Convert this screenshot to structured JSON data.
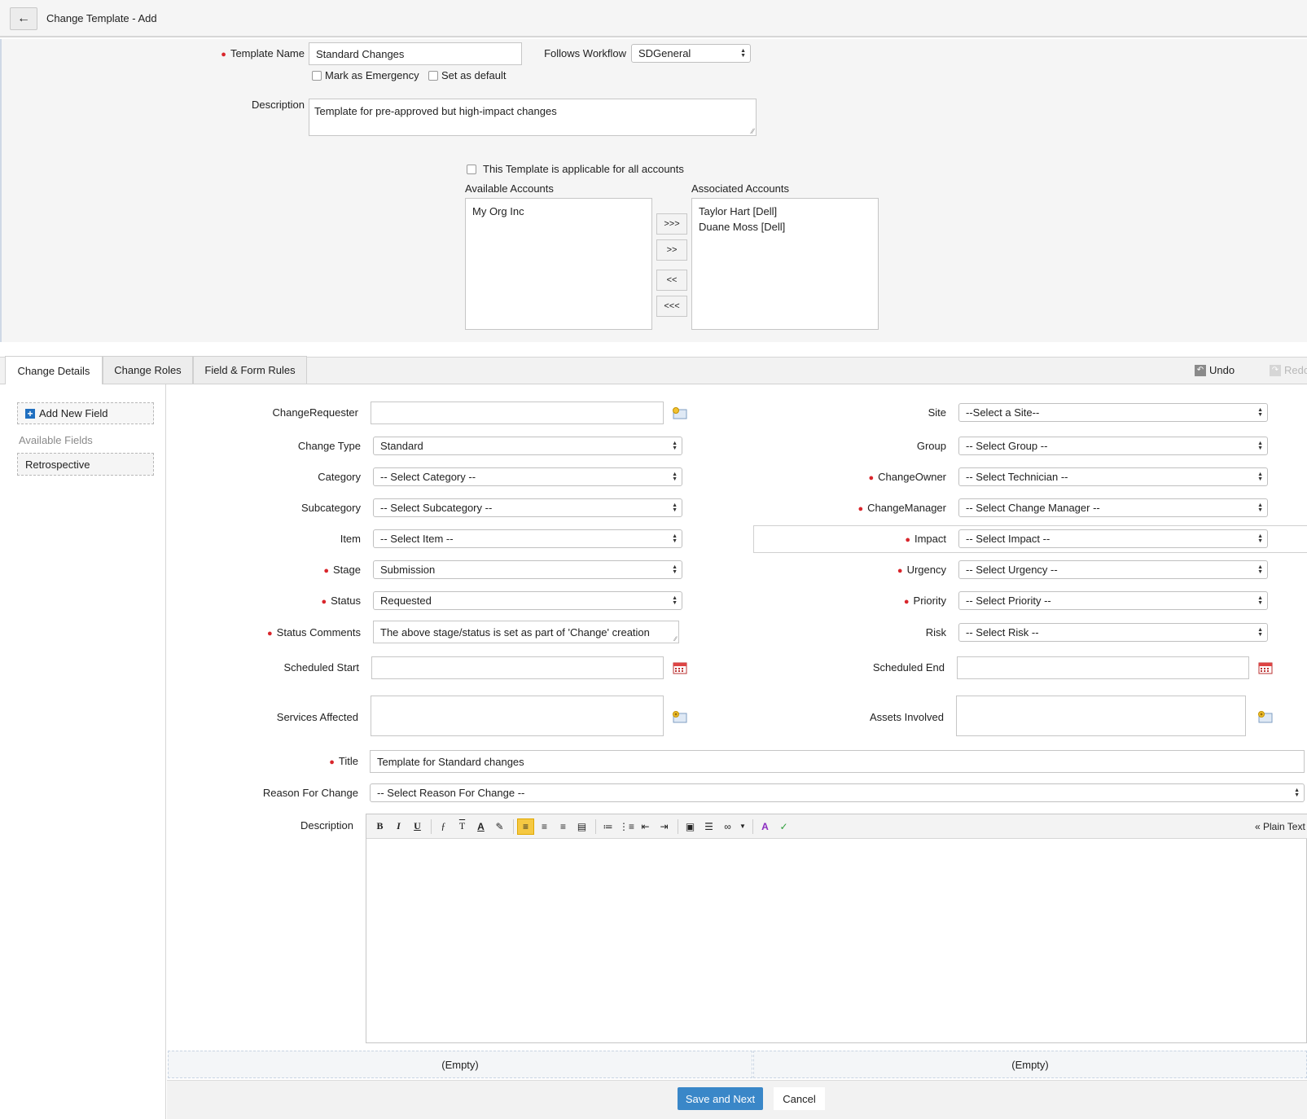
{
  "header": {
    "title": "Change Template - Add"
  },
  "template": {
    "name_label": "Template Name",
    "name_value": "Standard Changes",
    "workflow_label": "Follows Workflow",
    "workflow_value": "SDGeneral",
    "emergency_label": "Mark as Emergency",
    "default_label": "Set as default",
    "description_label": "Description",
    "description_value": "Template for pre-approved but high-impact changes"
  },
  "accounts": {
    "all_accounts_label": "This Template is applicable for all accounts",
    "available_label": "Available Accounts",
    "associated_label": "Associated Accounts",
    "available": [
      "My Org Inc"
    ],
    "associated": [
      "Taylor Hart [Dell]",
      "Duane Moss [Dell]"
    ],
    "move_all_right": ">>>",
    "move_right": ">>",
    "move_left": "<<",
    "move_all_left": "<<<"
  },
  "tabs": [
    {
      "label": "Change Details"
    },
    {
      "label": "Change Roles"
    },
    {
      "label": "Field & Form Rules"
    }
  ],
  "toolbar": {
    "undo": "Undo",
    "redo": "Redo"
  },
  "sidebar": {
    "add_field": "Add New Field",
    "available_fields": "Available Fields",
    "fields": [
      "Retrospective"
    ]
  },
  "form": {
    "change_requester": {
      "label": "ChangeRequester",
      "value": ""
    },
    "site": {
      "label": "Site",
      "value": "--Select a Site--"
    },
    "change_type": {
      "label": "Change Type",
      "value": "Standard"
    },
    "group": {
      "label": "Group",
      "value": "-- Select Group --"
    },
    "category": {
      "label": "Category",
      "value": "-- Select Category --"
    },
    "change_owner": {
      "label": "ChangeOwner",
      "value": "-- Select Technician --"
    },
    "subcategory": {
      "label": "Subcategory",
      "value": "-- Select Subcategory --"
    },
    "change_manager": {
      "label": "ChangeManager",
      "value": "-- Select Change Manager --"
    },
    "item": {
      "label": "Item",
      "value": "-- Select Item --"
    },
    "impact": {
      "label": "Impact",
      "value": "-- Select Impact --"
    },
    "stage": {
      "label": "Stage",
      "value": "Submission"
    },
    "urgency": {
      "label": "Urgency",
      "value": "-- Select Urgency --"
    },
    "status": {
      "label": "Status",
      "value": "Requested"
    },
    "priority": {
      "label": "Priority",
      "value": "-- Select Priority --"
    },
    "status_comments": {
      "label": "Status Comments",
      "value": "The above stage/status is set as part of 'Change' creation"
    },
    "risk": {
      "label": "Risk",
      "value": "-- Select Risk --"
    },
    "scheduled_start": {
      "label": "Scheduled Start",
      "value": ""
    },
    "scheduled_end": {
      "label": "Scheduled End",
      "value": ""
    },
    "services_affected": {
      "label": "Services Affected"
    },
    "assets_involved": {
      "label": "Assets Involved"
    },
    "title": {
      "label": "Title",
      "value": "Template for Standard changes"
    },
    "reason": {
      "label": "Reason For Change",
      "value": "-- Select Reason For Change --"
    },
    "description": {
      "label": "Description",
      "plain_text": "« Plain Text"
    }
  },
  "empty_slots": [
    "(Empty)",
    "(Empty)"
  ],
  "actions": {
    "save_next": "Save and Next",
    "cancel": "Cancel"
  },
  "colors": {
    "primary": "#3a87c8",
    "required": "#d9262c",
    "header_bg": "#f5f5f5",
    "tab_bg": "#ededed"
  }
}
